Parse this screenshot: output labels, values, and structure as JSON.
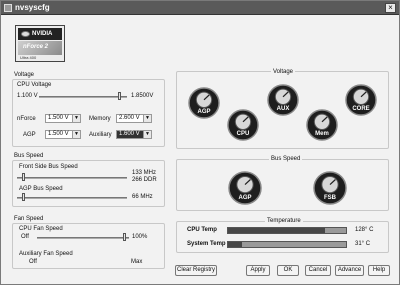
{
  "window": {
    "title": "nvsyscfg"
  },
  "logo": {
    "brand": "NVIDIA",
    "product": "nForce 2",
    "edition": "Ultra 400"
  },
  "voltage_panel": {
    "section_label": "Voltage",
    "cpu_voltage": {
      "label": "CPU Voltage",
      "min": "1.100 V",
      "max": "1.8500V",
      "level_fraction": 0.93
    },
    "selects": [
      {
        "label": "nForce",
        "value": "1.500 V"
      },
      {
        "label": "Memory",
        "value": "2.600 V"
      },
      {
        "label": "AGP",
        "value": "1.500 V"
      },
      {
        "label": "Auxiliary",
        "value": "1.600 V"
      }
    ]
  },
  "bus_panel": {
    "section_label": "Bus Speed",
    "fsb": {
      "label": "Front Side Bus Speed",
      "value_line1": "133 MHz",
      "value_line2": "266 DDR",
      "level_fraction": 0.05
    },
    "agp": {
      "label": "AGP Bus Speed",
      "value": "66 MHz",
      "level_fraction": 0.05
    }
  },
  "fan_panel": {
    "section_label": "Fan Speed",
    "cpu_fan": {
      "label": "CPU Fan Speed",
      "min": "Off",
      "max": "100%",
      "level_fraction": 0.97
    },
    "aux_fan": {
      "label": "Auxiliary Fan Speed",
      "min": "Off",
      "max": "Max"
    }
  },
  "voltage_gauges": {
    "title": "Voltage",
    "items": [
      {
        "label": "AGP"
      },
      {
        "label": "CPU"
      },
      {
        "label": "AUX"
      },
      {
        "label": "Mem"
      },
      {
        "label": "CORE"
      }
    ]
  },
  "bus_gauges": {
    "title": "Bus Speed",
    "items": [
      {
        "label": "AGP"
      },
      {
        "label": "FSB"
      }
    ]
  },
  "temperature": {
    "title": "Temperature",
    "rows": [
      {
        "label": "CPU Temp",
        "value": "128° C",
        "level_fraction": 0.82
      },
      {
        "label": "System Temp",
        "value": "31° C",
        "level_fraction": 0.12
      }
    ]
  },
  "buttons": {
    "clear_registry": "Clear Registry",
    "apply": "Apply",
    "ok": "OK",
    "cancel": "Cancel",
    "advance": "Advance",
    "help": "Help"
  },
  "colors": {
    "title_bar": "#5a5a5a",
    "gauge_face": "#2b2b2b",
    "bar_fill": "#474747"
  }
}
